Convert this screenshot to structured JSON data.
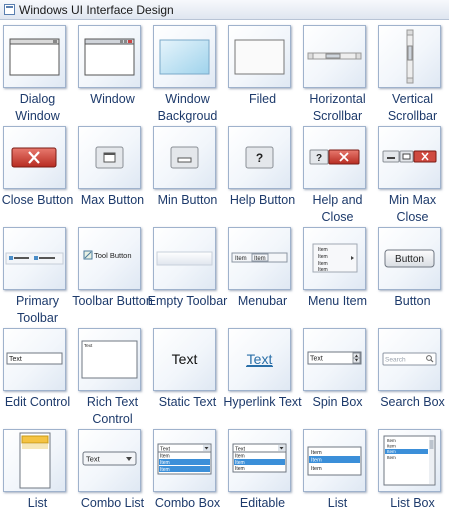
{
  "window": {
    "title": "Windows UI Interface Design"
  },
  "shapes": [
    {
      "label": "Dialog Window",
      "icon": "dialog-window-icon"
    },
    {
      "label": "Window",
      "icon": "window-icon"
    },
    {
      "label": "Window Backgroud",
      "icon": "window-background-icon"
    },
    {
      "label": "Filed",
      "icon": "filed-icon"
    },
    {
      "label": "Horizontal Scrollbar",
      "icon": "horizontal-scrollbar-icon"
    },
    {
      "label": "Vertical Scrollbar",
      "icon": "vertical-scrollbar-icon"
    },
    {
      "label": "Close Button",
      "icon": "close-button-icon"
    },
    {
      "label": "Max Button",
      "icon": "max-button-icon"
    },
    {
      "label": "Min Button",
      "icon": "min-button-icon"
    },
    {
      "label": "Help Button",
      "icon": "help-button-icon"
    },
    {
      "label": "Help and Close",
      "icon": "help-and-close-icon"
    },
    {
      "label": "Min Max Close",
      "icon": "min-max-close-icon"
    },
    {
      "label": "Primary Toolbar",
      "icon": "primary-toolbar-icon"
    },
    {
      "label": "Toolbar Button",
      "icon": "toolbar-button-icon"
    },
    {
      "label": "Empty Toolbar",
      "icon": "empty-toolbar-icon"
    },
    {
      "label": "Menubar",
      "icon": "menubar-icon"
    },
    {
      "label": "Menu Item",
      "icon": "menu-item-icon"
    },
    {
      "label": "Button",
      "icon": "button-icon"
    },
    {
      "label": "Edit Control",
      "icon": "edit-control-icon"
    },
    {
      "label": "Rich Text Control",
      "icon": "rich-text-control-icon"
    },
    {
      "label": "Static Text",
      "icon": "static-text-icon"
    },
    {
      "label": "Hyperlink Text",
      "icon": "hyperlink-text-icon"
    },
    {
      "label": "Spin Box",
      "icon": "spin-box-icon"
    },
    {
      "label": "Search Box",
      "icon": "search-box-icon"
    },
    {
      "label": "List",
      "icon": "list-icon"
    },
    {
      "label": "Combo List",
      "icon": "combo-list-icon"
    },
    {
      "label": "Combo Box",
      "icon": "combo-box-icon"
    },
    {
      "label": "Editable",
      "icon": "editable-combo-icon"
    },
    {
      "label": "List",
      "icon": "list-view-icon"
    },
    {
      "label": "List Box",
      "icon": "list-box-icon"
    }
  ],
  "thumb_text": {
    "tool_button": "Tool Button",
    "item": "Item",
    "button": "Button",
    "text": "Text",
    "search": "Search",
    "help": "?"
  },
  "colors": {
    "label": "#1d3a6b",
    "tile_border": "#9fb2cc",
    "close_red": "#d7443c",
    "selection_blue": "#3b8fd9",
    "hyperlink": "#2a6fa8"
  }
}
